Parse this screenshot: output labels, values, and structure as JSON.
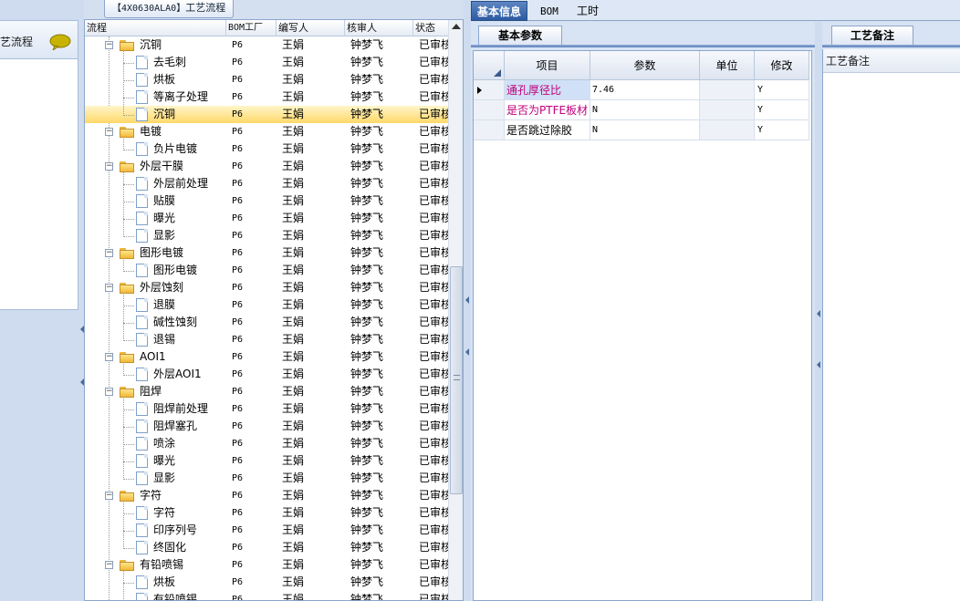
{
  "left_panel": {
    "item_label": "艺流程"
  },
  "middle": {
    "tab_code": "【4X0630ALA0】",
    "tab_title": "工艺流程",
    "columns": [
      "流程",
      "BOM工厂",
      "编写人",
      "核审人",
      "状态"
    ],
    "rows": [
      {
        "level": 0,
        "type": "folder",
        "name": "沉铜",
        "bom": "P6",
        "writer": "王娟",
        "reviewer": "钟梦飞",
        "status": "已审核"
      },
      {
        "level": 1,
        "type": "doc",
        "name": "去毛刺",
        "bom": "P6",
        "writer": "王娟",
        "reviewer": "钟梦飞",
        "status": "已审核"
      },
      {
        "level": 1,
        "type": "doc",
        "name": "烘板",
        "bom": "P6",
        "writer": "王娟",
        "reviewer": "钟梦飞",
        "status": "已审核"
      },
      {
        "level": 1,
        "type": "doc",
        "name": "等离子处理",
        "bom": "P6",
        "writer": "王娟",
        "reviewer": "钟梦飞",
        "status": "已审核"
      },
      {
        "level": 1,
        "type": "doc",
        "name": "沉铜",
        "bom": "P6",
        "writer": "王娟",
        "reviewer": "钟梦飞",
        "status": "已审核",
        "selected": true
      },
      {
        "level": 0,
        "type": "folder",
        "name": "电镀",
        "bom": "P6",
        "writer": "王娟",
        "reviewer": "钟梦飞",
        "status": "已审核"
      },
      {
        "level": 1,
        "type": "doc",
        "name": "负片电镀",
        "bom": "P6",
        "writer": "王娟",
        "reviewer": "钟梦飞",
        "status": "已审核"
      },
      {
        "level": 0,
        "type": "folder",
        "name": "外层干膜",
        "bom": "P6",
        "writer": "王娟",
        "reviewer": "钟梦飞",
        "status": "已审核"
      },
      {
        "level": 1,
        "type": "doc",
        "name": "外层前处理",
        "bom": "P6",
        "writer": "王娟",
        "reviewer": "钟梦飞",
        "status": "已审核"
      },
      {
        "level": 1,
        "type": "doc",
        "name": "贴膜",
        "bom": "P6",
        "writer": "王娟",
        "reviewer": "钟梦飞",
        "status": "已审核"
      },
      {
        "level": 1,
        "type": "doc",
        "name": "曝光",
        "bom": "P6",
        "writer": "王娟",
        "reviewer": "钟梦飞",
        "status": "已审核"
      },
      {
        "level": 1,
        "type": "doc",
        "name": "显影",
        "bom": "P6",
        "writer": "王娟",
        "reviewer": "钟梦飞",
        "status": "已审核"
      },
      {
        "level": 0,
        "type": "folder",
        "name": "图形电镀",
        "bom": "P6",
        "writer": "王娟",
        "reviewer": "钟梦飞",
        "status": "已审核"
      },
      {
        "level": 1,
        "type": "doc",
        "name": "图形电镀",
        "bom": "P6",
        "writer": "王娟",
        "reviewer": "钟梦飞",
        "status": "已审核"
      },
      {
        "level": 0,
        "type": "folder",
        "name": "外层蚀刻",
        "bom": "P6",
        "writer": "王娟",
        "reviewer": "钟梦飞",
        "status": "已审核"
      },
      {
        "level": 1,
        "type": "doc",
        "name": "退膜",
        "bom": "P6",
        "writer": "王娟",
        "reviewer": "钟梦飞",
        "status": "已审核"
      },
      {
        "level": 1,
        "type": "doc",
        "name": "碱性蚀刻",
        "bom": "P6",
        "writer": "王娟",
        "reviewer": "钟梦飞",
        "status": "已审核"
      },
      {
        "level": 1,
        "type": "doc",
        "name": "退锡",
        "bom": "P6",
        "writer": "王娟",
        "reviewer": "钟梦飞",
        "status": "已审核"
      },
      {
        "level": 0,
        "type": "folder",
        "name": "AOI1",
        "bom": "P6",
        "writer": "王娟",
        "reviewer": "钟梦飞",
        "status": "已审核"
      },
      {
        "level": 1,
        "type": "doc",
        "name": "外层AOI1",
        "bom": "P6",
        "writer": "王娟",
        "reviewer": "钟梦飞",
        "status": "已审核"
      },
      {
        "level": 0,
        "type": "folder",
        "name": "阻焊",
        "bom": "P6",
        "writer": "王娟",
        "reviewer": "钟梦飞",
        "status": "已审核"
      },
      {
        "level": 1,
        "type": "doc",
        "name": "阻焊前处理",
        "bom": "P6",
        "writer": "王娟",
        "reviewer": "钟梦飞",
        "status": "已审核"
      },
      {
        "level": 1,
        "type": "doc",
        "name": "阻焊塞孔",
        "bom": "P6",
        "writer": "王娟",
        "reviewer": "钟梦飞",
        "status": "已审核"
      },
      {
        "level": 1,
        "type": "doc",
        "name": "喷涂",
        "bom": "P6",
        "writer": "王娟",
        "reviewer": "钟梦飞",
        "status": "已审核"
      },
      {
        "level": 1,
        "type": "doc",
        "name": "曝光",
        "bom": "P6",
        "writer": "王娟",
        "reviewer": "钟梦飞",
        "status": "已审核"
      },
      {
        "level": 1,
        "type": "doc",
        "name": "显影",
        "bom": "P6",
        "writer": "王娟",
        "reviewer": "钟梦飞",
        "status": "已审核"
      },
      {
        "level": 0,
        "type": "folder",
        "name": "字符",
        "bom": "P6",
        "writer": "王娟",
        "reviewer": "钟梦飞",
        "status": "已审核"
      },
      {
        "level": 1,
        "type": "doc",
        "name": "字符",
        "bom": "P6",
        "writer": "王娟",
        "reviewer": "钟梦飞",
        "status": "已审核"
      },
      {
        "level": 1,
        "type": "doc",
        "name": "印序列号",
        "bom": "P6",
        "writer": "王娟",
        "reviewer": "钟梦飞",
        "status": "已审核"
      },
      {
        "level": 1,
        "type": "doc",
        "name": "终固化",
        "bom": "P6",
        "writer": "王娟",
        "reviewer": "钟梦飞",
        "status": "已审核"
      },
      {
        "level": 0,
        "type": "folder",
        "name": "有铅喷锡",
        "bom": "P6",
        "writer": "王娟",
        "reviewer": "钟梦飞",
        "status": "已审核"
      },
      {
        "level": 1,
        "type": "doc",
        "name": "烘板",
        "bom": "P6",
        "writer": "王娟",
        "reviewer": "钟梦飞",
        "status": "已审核"
      },
      {
        "level": 1,
        "type": "doc",
        "name": "有铅喷锡",
        "bom": "P6",
        "writer": "王娟",
        "reviewer": "钟梦飞",
        "status": "已审核"
      }
    ]
  },
  "top_tabs": [
    "基本信息",
    "BOM",
    "工时"
  ],
  "params": {
    "tab_label": "基本参数",
    "headers": [
      "项目",
      "参数",
      "单位",
      "修改"
    ],
    "rows": [
      {
        "item": "通孔厚径比",
        "value": "7.46",
        "unit": "",
        "modify": "Y",
        "current": true,
        "magenta": true
      },
      {
        "item": "是否为PTFE板材",
        "value": "N",
        "unit": "",
        "modify": "Y",
        "magenta": true
      },
      {
        "item": "是否跳过除胶",
        "value": "N",
        "unit": "",
        "modify": "Y",
        "magenta": false
      }
    ]
  },
  "notes": {
    "tab_label": "工艺备注",
    "label": "工艺备注"
  },
  "colors": {
    "selected_row": "#ffd86a",
    "active_tab": "#2c5ba3",
    "magenta_text": "#c0007a",
    "panel_bg": "#d8e3f3"
  }
}
